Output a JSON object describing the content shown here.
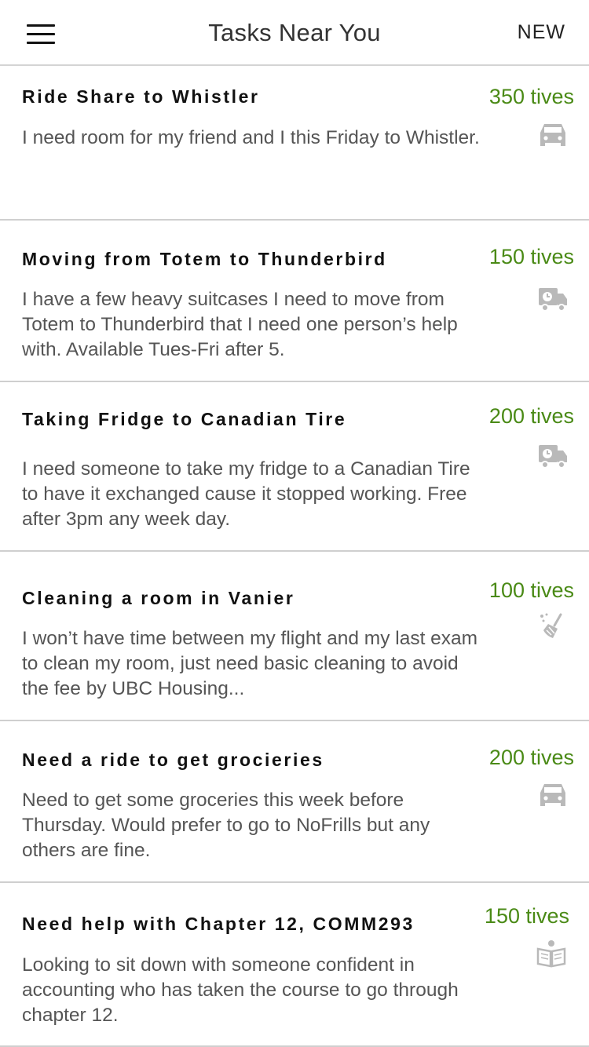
{
  "header": {
    "title": "Tasks Near You",
    "new_label": "NEW"
  },
  "tasks": [
    {
      "title": "Ride Share to Whistler",
      "reward": "350 tives",
      "description": "I need room for my friend and I this Friday to Whistler.",
      "icon": "car-icon"
    },
    {
      "title": "Moving from Totem to Thunderbird",
      "reward": "150 tives",
      "description": "I have a few heavy suitcases I need to move from Totem to Thunderbird that I need one person’s help with. Available Tues-Fri after 5.",
      "icon": "delivery-truck-icon"
    },
    {
      "title": "Taking Fridge to Canadian Tire",
      "reward": "200 tives",
      "description": "I need someone to take my fridge to a Canadian Tire to have it exchanged cause it stopped working. Free after 3pm any week day.",
      "icon": "delivery-truck-icon"
    },
    {
      "title": "Cleaning a room in Vanier",
      "reward": "100 tives",
      "description": "I won’t have time between my flight and my last exam to clean my room, just need basic cleaning to avoid the fee by UBC Housing...",
      "icon": "broom-icon"
    },
    {
      "title": "Need a ride to get grocieries",
      "reward": "200 tives",
      "description": "Need to get some groceries this week before Thursday. Would prefer to go to NoFrills but any others are fine.",
      "icon": "car-icon"
    },
    {
      "title": "Need help with Chapter 12, COMM293",
      "reward": "150 tives",
      "description": "Looking to sit down with someone confident in accounting who has taken the course to go through chapter 12.",
      "icon": "study-book-icon"
    }
  ],
  "colors": {
    "reward": "#4a8a16",
    "icon": "#b9b9b9",
    "divider": "#cfcfcf"
  }
}
